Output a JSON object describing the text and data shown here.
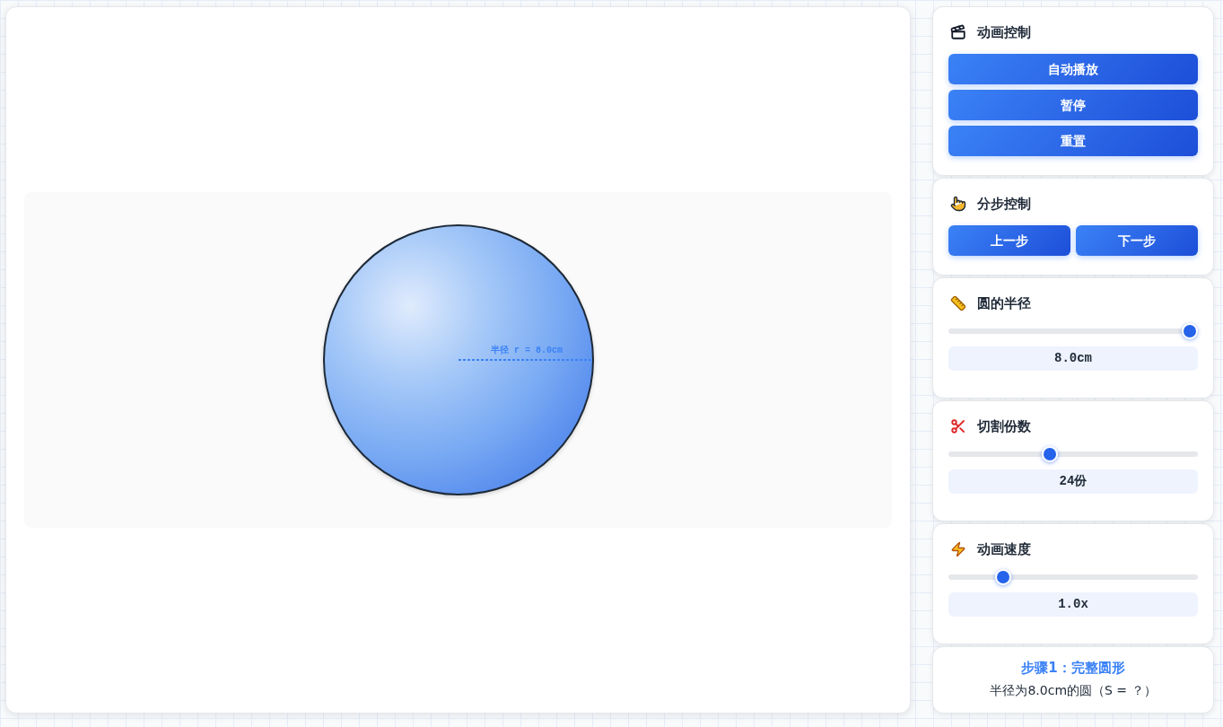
{
  "canvas": {
    "radius_label": "半径 r = 8.0cm"
  },
  "panels": [
    {
      "kind": "button_column",
      "title": "动画控制",
      "buttons": [
        "自动播放",
        "暂停",
        "重置"
      ]
    },
    {
      "kind": "button_row",
      "title": "分步控制",
      "buttons": [
        "上一步",
        "下一步"
      ]
    },
    {
      "kind": "slider",
      "title": "圆的半径",
      "level": 1.0,
      "reading": "8.0cm"
    },
    {
      "kind": "slider",
      "title": "切割份数",
      "level": 0.4,
      "reading": "24份"
    },
    {
      "kind": "slider",
      "title": "动画速度",
      "level": 0.2,
      "reading": "1.0x"
    },
    {
      "kind": "step",
      "title": "步骤1：完整圆形",
      "text": "半径为8.0cm的圆（S = ？）"
    }
  ]
}
